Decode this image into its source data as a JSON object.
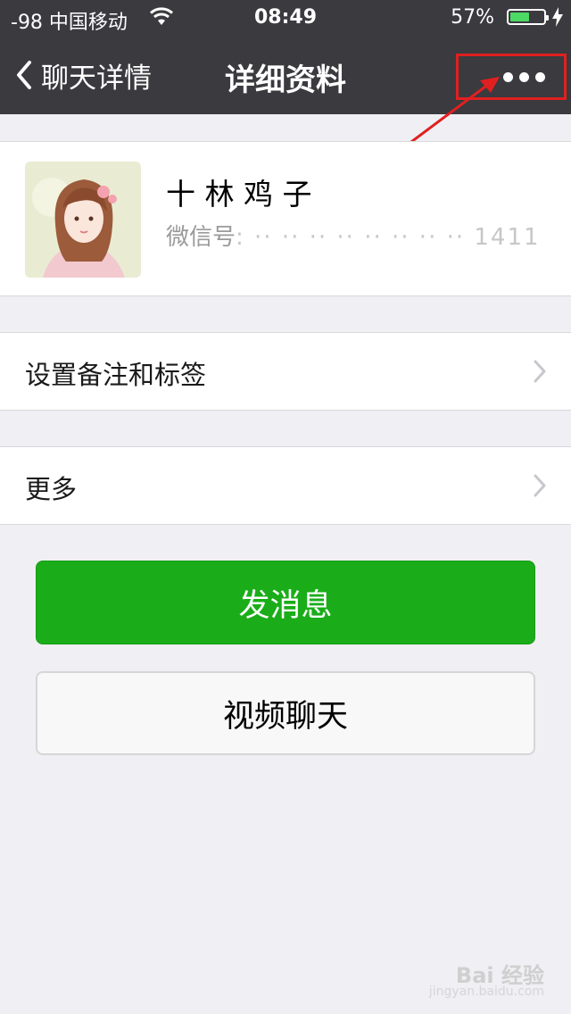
{
  "status_bar": {
    "signal_carrier": "-98 中国移动",
    "time": "08:49",
    "battery_percent": "57%",
    "battery_level": 0.57,
    "battery_color": "#4cd964"
  },
  "nav": {
    "back_label": "聊天详情",
    "title": "详细资料",
    "more_icon": "ellipsis-icon",
    "annotation_color": "#e02020"
  },
  "profile": {
    "name": "十 林 鸡 子",
    "wechat_id_label": "微信号",
    "wechat_id_value": ": ·· ·· ·· ·· ·· ·· ·· ·· 1411"
  },
  "rows": [
    {
      "label": "设置备注和标签"
    },
    {
      "label": "更多"
    }
  ],
  "buttons": {
    "send_message": "发消息",
    "video_call": "视频聊天",
    "primary_color": "#1aad19"
  },
  "watermark": {
    "text": "Bai 经验",
    "sub": "jingyan.baidu.com"
  }
}
